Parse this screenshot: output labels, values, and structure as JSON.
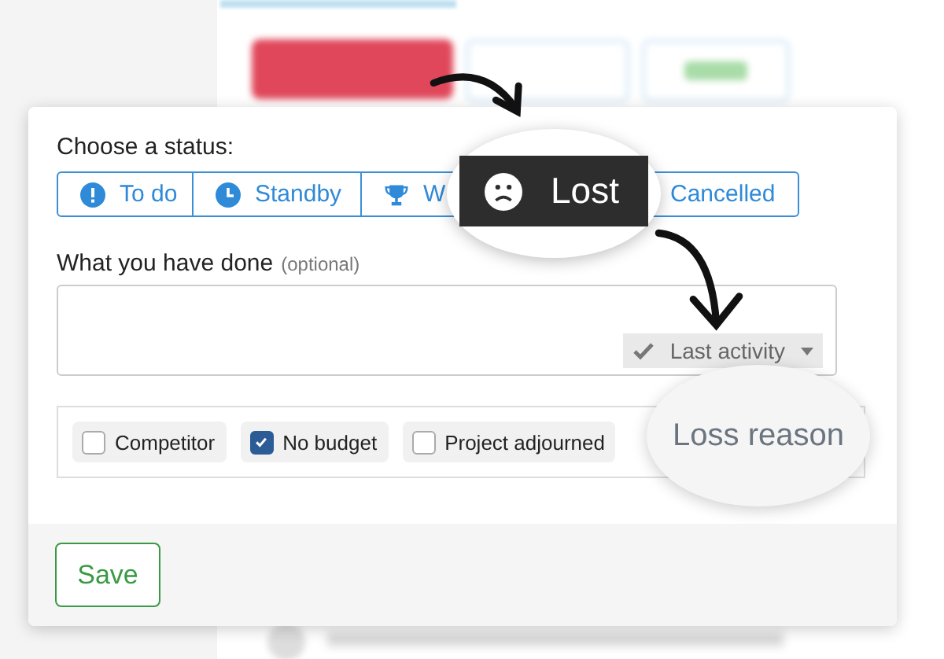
{
  "status_prompt": "Choose a status:",
  "statuses": [
    {
      "label": "To do",
      "kind": "alert",
      "selected": false
    },
    {
      "label": "Standby",
      "kind": "clock",
      "selected": false
    },
    {
      "label": "W",
      "kind": "trophy",
      "selected": false
    },
    {
      "label": "Lost",
      "kind": "sad",
      "selected": true
    },
    {
      "label": "Cancelled",
      "kind": "none",
      "selected": false
    }
  ],
  "notes": {
    "label": "What you have done",
    "hint": "(optional)",
    "type_dropdown": "Last activity"
  },
  "loss_reason": {
    "title": "Loss reason",
    "options": [
      {
        "label": "Competitor",
        "checked": false
      },
      {
        "label": "No budget",
        "checked": true
      },
      {
        "label": "Project adjourned",
        "checked": false
      }
    ]
  },
  "save_button": "Save"
}
